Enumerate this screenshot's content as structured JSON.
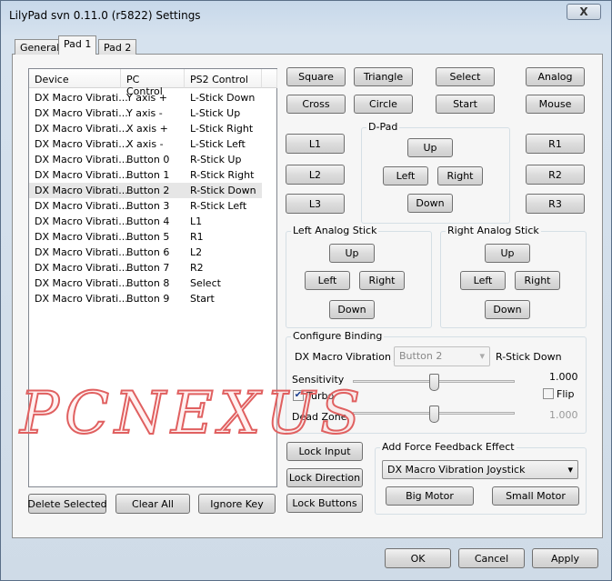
{
  "window": {
    "title": "LilyPad svn 0.11.0 (r5822) Settings",
    "close_label": "X"
  },
  "tabs": [
    {
      "label": "General"
    },
    {
      "label": "Pad 1",
      "active": true
    },
    {
      "label": "Pad 2"
    }
  ],
  "list": {
    "columns": [
      "Device",
      "PC Control",
      "PS2 Control"
    ],
    "rows": [
      [
        "DX Macro Vibrati...",
        "Y axis +",
        "L-Stick Down"
      ],
      [
        "DX Macro Vibrati...",
        "Y axis -",
        "L-Stick Up"
      ],
      [
        "DX Macro Vibrati...",
        "X axis +",
        "L-Stick Right"
      ],
      [
        "DX Macro Vibrati...",
        "X axis -",
        "L-Stick Left"
      ],
      [
        "DX Macro Vibrati...",
        "Button 0",
        "R-Stick Up"
      ],
      [
        "DX Macro Vibrati...",
        "Button 1",
        "R-Stick Right"
      ],
      [
        "DX Macro Vibrati...",
        "Button 2",
        "R-Stick Down"
      ],
      [
        "DX Macro Vibrati...",
        "Button 3",
        "R-Stick Left"
      ],
      [
        "DX Macro Vibrati...",
        "Button 4",
        "L1"
      ],
      [
        "DX Macro Vibrati...",
        "Button 5",
        "R1"
      ],
      [
        "DX Macro Vibrati...",
        "Button 6",
        "L2"
      ],
      [
        "DX Macro Vibrati...",
        "Button 7",
        "R2"
      ],
      [
        "DX Macro Vibrati...",
        "Button 8",
        "Select"
      ],
      [
        "DX Macro Vibrati...",
        "Button 9",
        "Start"
      ]
    ],
    "selected_index": 6
  },
  "buttons": {
    "square": "Square",
    "triangle": "Triangle",
    "select": "Select",
    "analog": "Analog",
    "cross": "Cross",
    "circle": "Circle",
    "start": "Start",
    "mouse": "Mouse",
    "l1": "L1",
    "l2": "L2",
    "l3": "L3",
    "r1": "R1",
    "r2": "R2",
    "r3": "R3"
  },
  "dpad": {
    "label": "D-Pad",
    "up": "Up",
    "left": "Left",
    "right": "Right",
    "down": "Down"
  },
  "left_stick": {
    "label": "Left Analog Stick",
    "up": "Up",
    "left": "Left",
    "right": "Right",
    "down": "Down"
  },
  "right_stick": {
    "label": "Right Analog Stick",
    "up": "Up",
    "left": "Left",
    "right": "Right",
    "down": "Down"
  },
  "binding": {
    "label": "Configure Binding",
    "device": "DX Macro Vibration Joy",
    "control_value": "Button 2",
    "target": "R-Stick Down",
    "sensitivity_label": "Sensitivity",
    "sensitivity_value": "1.000",
    "turbo_label": "Turbo",
    "turbo_checked": true,
    "flip_label": "Flip",
    "flip_checked": false,
    "deadzone_label": "Dead Zone",
    "deadzone_value": "1.000"
  },
  "lock": {
    "input": "Lock Input",
    "direction": "Lock Direction",
    "buttons": "Lock Buttons"
  },
  "force_feedback": {
    "label": "Add Force Feedback Effect",
    "device": "DX Macro Vibration Joystick",
    "big_motor": "Big Motor",
    "small_motor": "Small Motor"
  },
  "list_actions": {
    "delete": "Delete Selected",
    "clear": "Clear All",
    "ignore": "Ignore Key"
  },
  "dialog": {
    "ok": "OK",
    "cancel": "Cancel",
    "apply": "Apply"
  },
  "watermark": "PCNEXUS"
}
